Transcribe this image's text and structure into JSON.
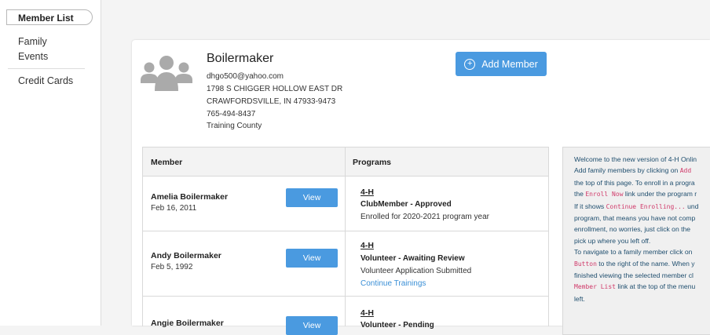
{
  "sidebar": {
    "member_list": "Member List",
    "items": [
      {
        "label": "Family"
      },
      {
        "label": "Events"
      },
      {
        "label": "Credit Cards"
      }
    ]
  },
  "profile": {
    "name": "Boilermaker",
    "email": "dhgo500@yahoo.com",
    "address1": "1798 S CHIGGER HOLLOW EAST DR",
    "address2": "CRAWFORDSVILLE, IN 47933-9473",
    "phone": "765-494-8437",
    "county": "Training County"
  },
  "add_member_label": "Add Member",
  "table": {
    "headers": {
      "member": "Member",
      "programs": "Programs"
    },
    "rows": [
      {
        "name": "Amelia Boilermaker",
        "dob": "Feb 16, 2011",
        "view": "View",
        "program": "4-H",
        "status": "ClubMember - Approved",
        "detail": "Enrolled for 2020-2021 program year",
        "link": ""
      },
      {
        "name": "Andy Boilermaker",
        "dob": "Feb 5, 1992",
        "view": "View",
        "program": "4-H",
        "status": "Volunteer - Awaiting Review",
        "detail": "Volunteer Application Submitted",
        "link": "Continue Trainings"
      },
      {
        "name": "Angie Boilermaker",
        "dob": "",
        "view": "View",
        "program": "4-H",
        "status": "Volunteer - Pending",
        "detail": "",
        "link": ""
      }
    ]
  },
  "welcome": {
    "l1": "Welcome to the new version of 4-H Onlin",
    "l2a": "Add family members by clicking on ",
    "l2code": "Add",
    "l3": "the top of this page. To enroll in a progra",
    "l4a": "the ",
    "l4code": "Enroll Now",
    "l4b": " link under the program r",
    "l5a": "If it shows ",
    "l5code": "Continue Enrolling...",
    "l5b": " und",
    "l6": "program, that means you have not comp",
    "l7": "enrollment, no worries, just click on the",
    "l8": "pick up where you left off.",
    "l9": "To navigate to a family member click on",
    "l10code": "Button",
    "l10b": " to the right of the name. When y",
    "l11": "finished viewing the selected member cl",
    "l12code": "Member List",
    "l12b": " link at the top of the menu",
    "l13": "left."
  }
}
